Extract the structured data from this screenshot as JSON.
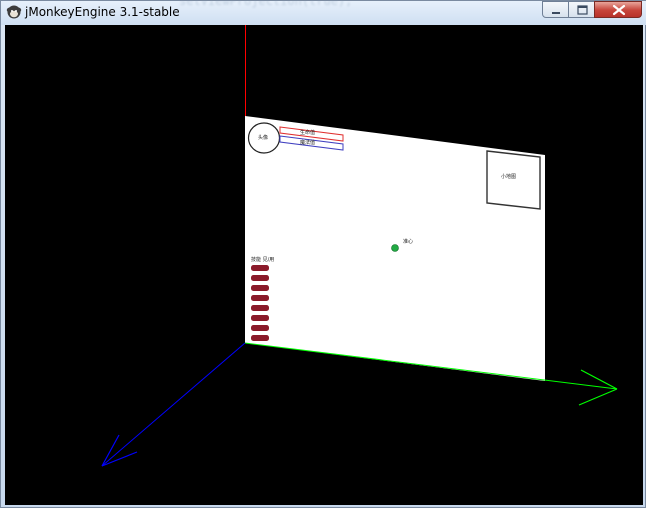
{
  "window": {
    "title": "jMonkeyEngine 3.1-stable",
    "background_code": "setViewProjection(true);"
  },
  "titlebar_buttons": {
    "minimize_icon": "minimize-icon",
    "maximize_icon": "maximize-icon",
    "close_icon": "close-icon"
  },
  "hud": {
    "avatar_label": "头像",
    "health_bar_label": "生命值",
    "mana_bar_label": "魔法值",
    "minimap_label": "小地图",
    "crosshair_label": "准心",
    "skills_label": "技能 见/用",
    "skill_slots": 8
  },
  "colors": {
    "x_axis": "#00ff00",
    "y_axis": "#ff0000",
    "z_axis": "#0000ff",
    "health_border": "#e03030",
    "mana_border": "#4040c0",
    "skill_slot": "#8b1a2a",
    "crosshair": "#22aa44"
  }
}
